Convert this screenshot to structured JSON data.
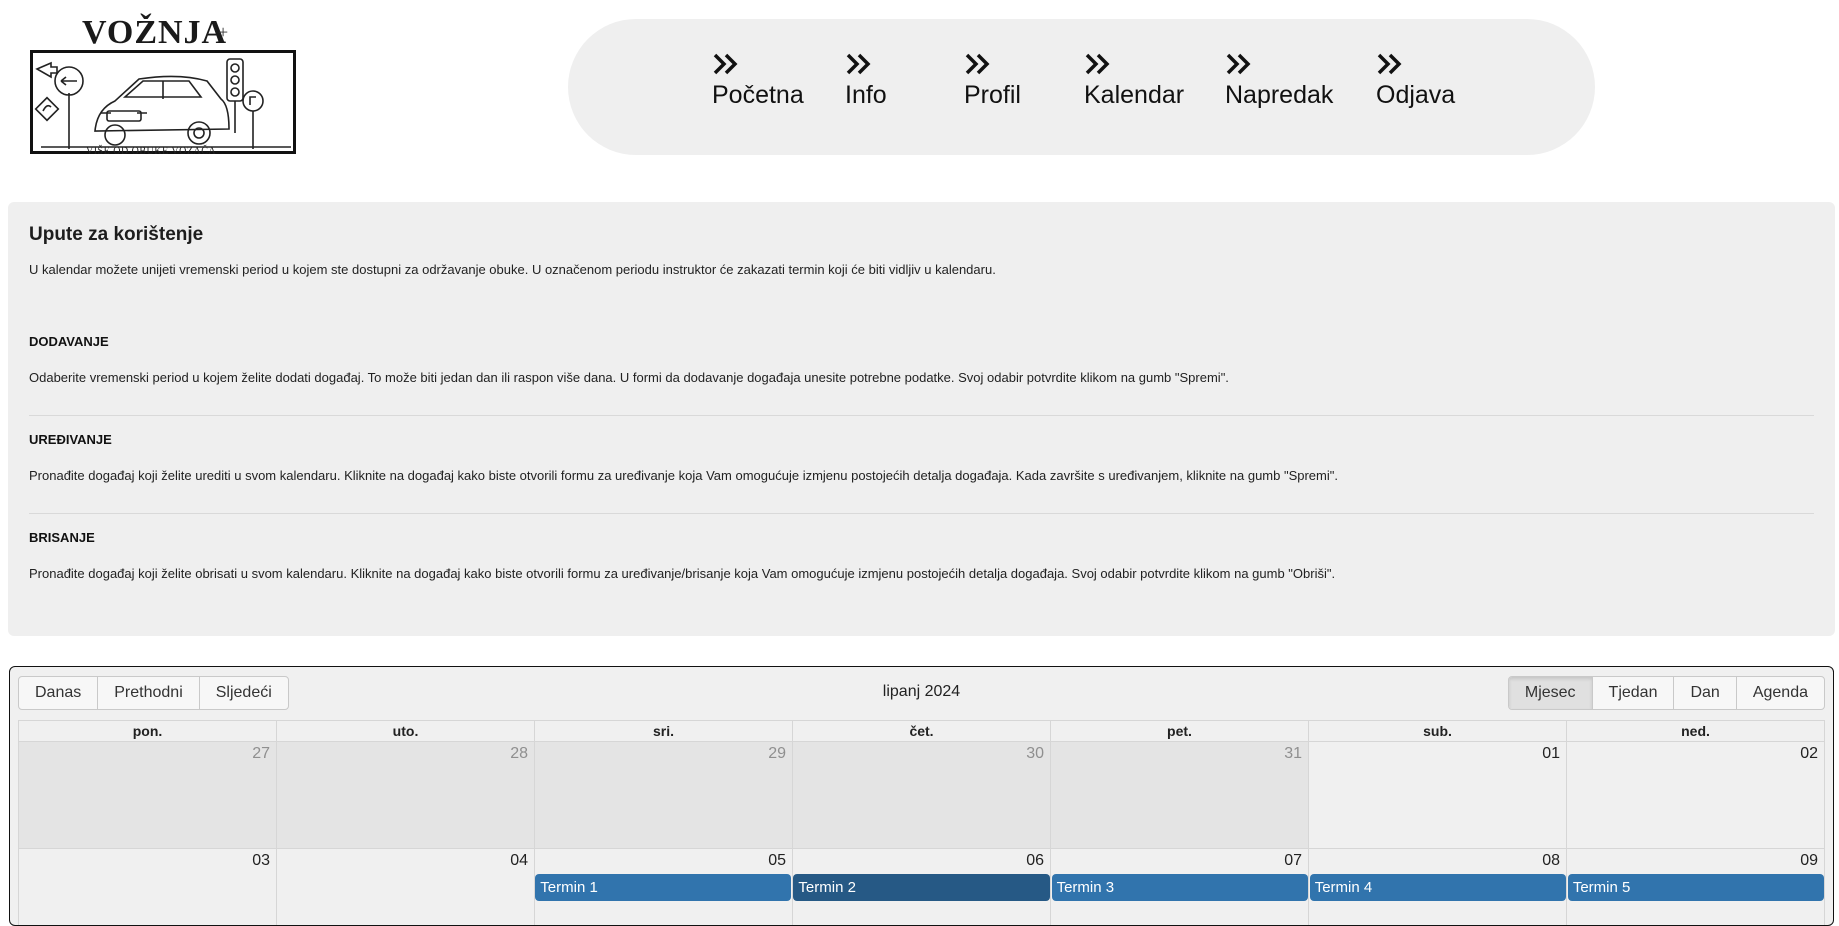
{
  "logo": {
    "title": "VOŽNJA",
    "plus": "+",
    "tagline": "VIŠE OD OBUKE VOZAČA"
  },
  "nav": {
    "items": [
      {
        "label": "Početna",
        "icon": "double-chevron-right-icon"
      },
      {
        "label": "Info",
        "icon": "double-chevron-right-icon"
      },
      {
        "label": "Profil",
        "icon": "double-chevron-right-icon"
      },
      {
        "label": "Kalendar",
        "icon": "double-chevron-right-icon"
      },
      {
        "label": "Napredak",
        "icon": "double-chevron-right-icon"
      },
      {
        "label": "Odjava",
        "icon": "double-chevron-right-icon"
      }
    ]
  },
  "instructions": {
    "title": "Upute za korištenje",
    "intro": "U kalendar možete unijeti vremenski period u kojem ste dostupni za održavanje obuke. U označenom periodu instruktor će zakazati termin koji će biti vidljiv u kalendaru.",
    "sections": [
      {
        "heading": "DODAVANJE",
        "text": "Odaberite vremenski period u kojem želite dodati događaj. To može biti jedan dan ili raspon više dana. U formi da dodavanje događaja unesite potrebne podatke. Svoj odabir potvrdite klikom na gumb \"Spremi\"."
      },
      {
        "heading": "UREĐIVANJE",
        "text": "Pronađite događaj koji želite urediti u svom kalendaru. Kliknite na događaj kako biste otvorili formu za uređivanje koja Vam omogućuje izmjenu postojećih detalja događaja. Kada završite s uređivanjem, kliknite na gumb \"Spremi\"."
      },
      {
        "heading": "BRISANJE",
        "text": "Pronađite događaj koji želite obrisati u svom kalendaru. Kliknite na događaj kako biste otvorili formu za uređivanje/brisanje koja Vam omogućuje izmjenu postojećih detalja događaja. Svoj odabir potvrdite klikom na gumb \"Obriši\"."
      }
    ]
  },
  "calendar": {
    "nav_buttons": [
      "Danas",
      "Prethodni",
      "Sljedeći"
    ],
    "title": "lipanj 2024",
    "view_buttons": [
      "Mjesec",
      "Tjedan",
      "Dan",
      "Agenda"
    ],
    "active_view": "Mjesec",
    "weekdays": [
      "pon.",
      "uto.",
      "sri.",
      "čet.",
      "pet.",
      "sub.",
      "ned."
    ],
    "weeks": [
      [
        "27",
        "28",
        "29",
        "30",
        "31",
        "01",
        "02"
      ],
      [
        "03",
        "04",
        "05",
        "06",
        "07",
        "08",
        "09"
      ]
    ],
    "week1_off_days": 5,
    "events": [
      "",
      "",
      "Termin 1",
      "Termin 2",
      "Termin 3",
      "Termin 4",
      "Termin 5"
    ],
    "selected_event": "Termin 2",
    "colors": {
      "event": "#3174ad",
      "event_selected": "#265985"
    }
  }
}
